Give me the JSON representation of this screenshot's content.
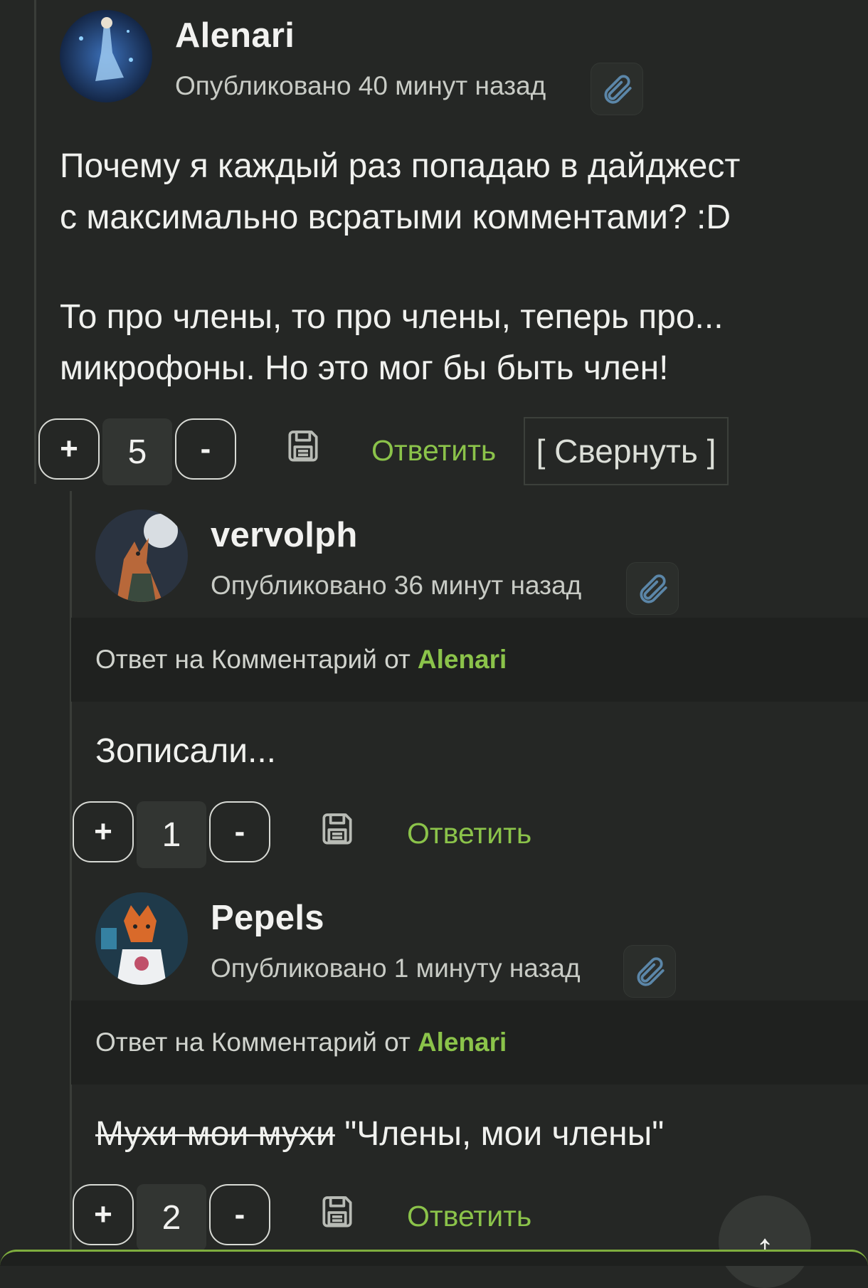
{
  "comments": [
    {
      "author": "Alenari",
      "published": "Опубликовано 40 минут назад",
      "text_lines": [
        "Почему я каждый раз попадаю в дайджест",
        "с максимально всратыми комментами? :D",
        "",
        "То про члены, то про члены, теперь про...",
        "микрофоны. Но это мог бы быть член!"
      ],
      "score": "5",
      "reply_label": "Ответить",
      "collapse_label": "[ Свернуть ]"
    },
    {
      "author": "vervolph",
      "published": "Опубликовано 36 минут назад",
      "reply_to_prefix": "Ответ на Комментарий от",
      "reply_to_author": "Alenari",
      "text": "Зописали...",
      "score": "1",
      "reply_label": "Ответить"
    },
    {
      "author": "Pepels",
      "published": "Опубликовано 1 минуту назад",
      "reply_to_prefix": "Ответ на Комментарий от",
      "reply_to_author": "Alenari",
      "text_struck": "Мухи мои мухи",
      "text": " \"Члены, мои члены\"",
      "score": "2",
      "reply_label": "Ответить"
    }
  ],
  "vote": {
    "plus": "+",
    "minus": "-"
  },
  "scroll_top_icon": "↑",
  "colors": {
    "accent": "#8bc34a",
    "background": "#252725",
    "banner": "#1f211f"
  },
  "icons": [
    "paperclip-icon",
    "save-icon",
    "arrow-up-icon"
  ]
}
